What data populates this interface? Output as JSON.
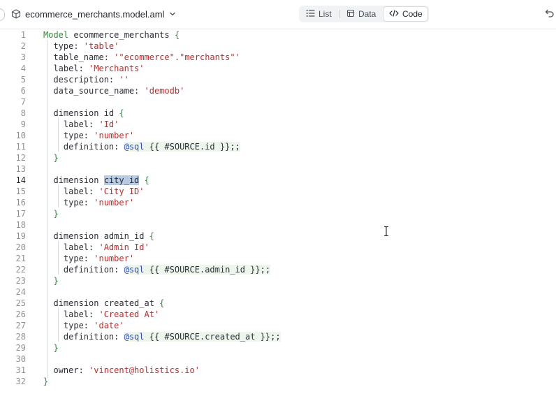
{
  "header": {
    "file_name": "ecommerce_merchants.model.aml",
    "views": [
      {
        "label": "List",
        "icon": "list-icon"
      },
      {
        "label": "Data",
        "icon": "table-icon"
      },
      {
        "label": "Code",
        "icon": "code-icon",
        "active": true
      }
    ]
  },
  "editor": {
    "current_line": 14,
    "lines": [
      {
        "n": "1"
      },
      {
        "n": "2"
      },
      {
        "n": "3"
      },
      {
        "n": "4"
      },
      {
        "n": "5"
      },
      {
        "n": "6"
      },
      {
        "n": "7"
      },
      {
        "n": "8"
      },
      {
        "n": "9"
      },
      {
        "n": "10"
      },
      {
        "n": "11"
      },
      {
        "n": "12"
      },
      {
        "n": "13"
      },
      {
        "n": "14"
      },
      {
        "n": "15"
      },
      {
        "n": "16"
      },
      {
        "n": "17"
      },
      {
        "n": "18"
      },
      {
        "n": "19"
      },
      {
        "n": "20"
      },
      {
        "n": "21"
      },
      {
        "n": "22"
      },
      {
        "n": "23"
      },
      {
        "n": "24"
      },
      {
        "n": "25"
      },
      {
        "n": "26"
      },
      {
        "n": "27"
      },
      {
        "n": "28"
      },
      {
        "n": "29"
      },
      {
        "n": "30"
      },
      {
        "n": "31"
      },
      {
        "n": "32"
      }
    ],
    "code": {
      "l1": {
        "kw": "Model",
        "name": " ecommerce_merchants ",
        "brace": "{"
      },
      "l2": {
        "key": "  type: ",
        "val": "'table'"
      },
      "l3": {
        "key": "  table_name: ",
        "val": "'\"ecommerce\".\"merchants\"'"
      },
      "l4": {
        "key": "  label: ",
        "val": "'Merchants'"
      },
      "l5": {
        "key": "  description: ",
        "val": "''"
      },
      "l6": {
        "key": "  data_source_name: ",
        "val": "'demodb'"
      },
      "l8": {
        "pre": "  dimension id ",
        "brace": "{"
      },
      "l9": {
        "key": "    label: ",
        "val": "'Id'"
      },
      "l10": {
        "key": "    type: ",
        "val": "'number'"
      },
      "l11": {
        "key": "    definition: ",
        "dec": "@sql",
        "tpl": " {{ #SOURCE.id }};;"
      },
      "l12": {
        "brace": "  }"
      },
      "l14": {
        "pre": "  dimension ",
        "sel": "city_id",
        "post": " ",
        "brace": "{"
      },
      "l15": {
        "key": "    label: ",
        "val": "'City ID'"
      },
      "l16": {
        "key": "    type: ",
        "val": "'number'"
      },
      "l17": {
        "brace": "  }"
      },
      "l19": {
        "pre": "  dimension admin_id ",
        "brace": "{"
      },
      "l20": {
        "key": "    label: ",
        "val": "'Admin Id'"
      },
      "l21": {
        "key": "    type: ",
        "val": "'number'"
      },
      "l22": {
        "key": "    definition: ",
        "dec": "@sql",
        "tpl": " {{ #SOURCE.admin_id }};;"
      },
      "l23": {
        "brace": "  }"
      },
      "l25": {
        "pre": "  dimension created_at ",
        "brace": "{"
      },
      "l26": {
        "key": "    label: ",
        "val": "'Created At'"
      },
      "l27": {
        "key": "    type: ",
        "val": "'date'"
      },
      "l28": {
        "key": "    definition: ",
        "dec": "@sql",
        "tpl": " {{ #SOURCE.created_at }};;"
      },
      "l29": {
        "brace": "  }"
      },
      "l31": {
        "key": "  owner: ",
        "val": "'vincent@holistics.io'"
      },
      "l32": {
        "brace": "}"
      }
    }
  }
}
